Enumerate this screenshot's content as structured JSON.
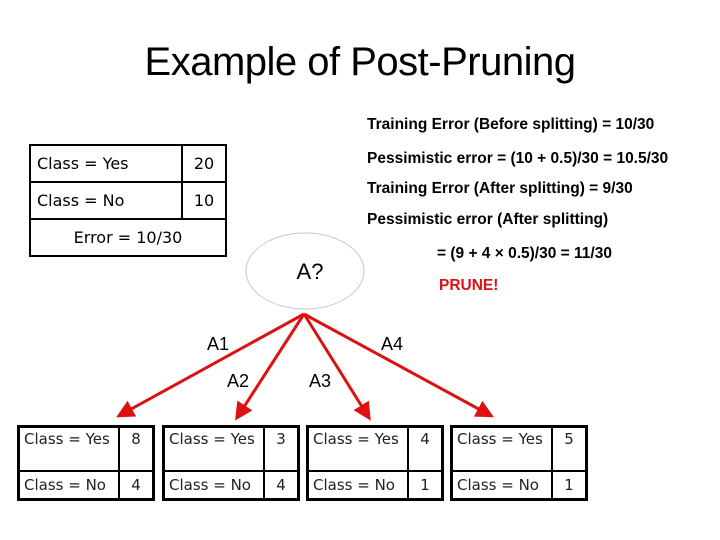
{
  "title": "Example of Post-Pruning",
  "root_node": {
    "rows": [
      {
        "label": "Class = Yes",
        "count": "20"
      },
      {
        "label": "Class = No",
        "count": "10"
      }
    ],
    "error": "Error = 10/30",
    "split_label": "A?"
  },
  "calculations": {
    "training_error_before": "Training Error (Before splitting) = 10/30",
    "pessimistic_error_before": "Pessimistic error = (10 + 0.5)/30 = 10.5/30",
    "training_error_after": "Training Error (After splitting) = 9/30",
    "pessimistic_error_after_label": "Pessimistic error (After splitting)",
    "pessimistic_error_after_value": "= (9 + 4 × 0.5)/30 = 11/30",
    "decision": "PRUNE!"
  },
  "edges": [
    "A1",
    "A2",
    "A3",
    "A4"
  ],
  "leaves": [
    {
      "yes_label": "Class = Yes",
      "yes_count": "8",
      "no_label": "Class = No",
      "no_count": "4"
    },
    {
      "yes_label": "Class = Yes",
      "yes_count": "3",
      "no_label": "Class = No",
      "no_count": "4"
    },
    {
      "yes_label": "Class = Yes",
      "yes_count": "4",
      "no_label": "Class = No",
      "no_count": "1"
    },
    {
      "yes_label": "Class = Yes",
      "yes_count": "5",
      "no_label": "Class = No",
      "no_count": "1"
    }
  ],
  "colors": {
    "arrow": "#dd1111",
    "prune_text": "#dd1111",
    "node_outline": "#c8c8c8"
  }
}
